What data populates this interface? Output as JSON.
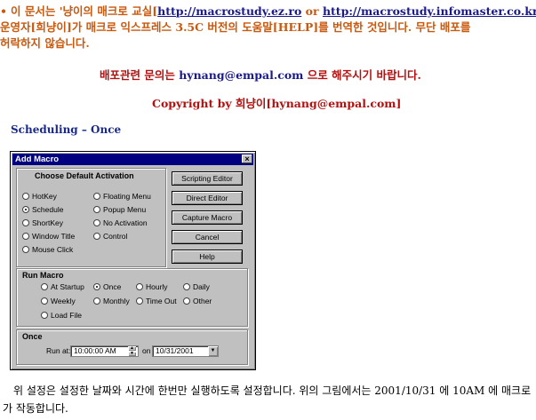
{
  "header": {
    "bullet": "•",
    "line1_prefix": "이 문서는 '냥이의 매크로 교실[",
    "link1": "http://macrostudy.ez.ro",
    "line1_or": " or ",
    "link2": "http://macrostudy.infomaster.co.kr",
    "line1_suffix": "]'",
    "line2": "운영자[희냥이]가 매크로 익스프레스 3.5C 버전의 도움말[HELP]를 번역한 것입니다. 무단 배포를",
    "line3": "허락하지 않습니다.",
    "contact_prefix": "배포관련 문의는 ",
    "contact_email": "hynang@empal.com",
    "contact_suffix": " 으로 해주시기 바랍니다.",
    "copyright": "Copyright by 희냥이[hynang@empal.com]"
  },
  "section_title": "Scheduling – Once",
  "dialog": {
    "title": "Add Macro",
    "close_glyph": "×",
    "activation": {
      "title": "Choose Default Activation",
      "options": [
        {
          "label": "HotKey",
          "selected": false
        },
        {
          "label": "Schedule",
          "selected": true
        },
        {
          "label": "ShortKey",
          "selected": false
        },
        {
          "label": "Window Title",
          "selected": false
        },
        {
          "label": "Mouse Click",
          "selected": false
        },
        {
          "label": "Floating Menu",
          "selected": false
        },
        {
          "label": "Popup Menu",
          "selected": false
        },
        {
          "label": "No Activation",
          "selected": false
        },
        {
          "label": "Control",
          "selected": false
        }
      ]
    },
    "buttons": {
      "scripting_editor": "Scripting Editor",
      "direct_editor": "Direct Editor",
      "capture_macro": "Capture Macro",
      "cancel": "Cancel",
      "help": "Help"
    },
    "run_macro": {
      "title": "Run Macro",
      "options": [
        {
          "label": "At Startup",
          "selected": false
        },
        {
          "label": "Once",
          "selected": true
        },
        {
          "label": "Hourly",
          "selected": false
        },
        {
          "label": "Daily",
          "selected": false
        },
        {
          "label": "Weekly",
          "selected": false
        },
        {
          "label": "Monthly",
          "selected": false
        },
        {
          "label": "Time Out",
          "selected": false
        },
        {
          "label": "Other",
          "selected": false
        },
        {
          "label": "Load File",
          "selected": false
        }
      ]
    },
    "once": {
      "title": "Once",
      "run_at_label": "Run at:",
      "time_value": "10:00:00 AM",
      "on_label": "on",
      "date_value": "10/31/2001",
      "spin_up": "▲",
      "spin_down": "▼",
      "dropdown_glyph": "▼"
    }
  },
  "footer": {
    "text": "위 설정은 설정한 날짜와 시간에 한번만 실행하도록 설정합니다. 위의 그림에서는 2001/10/31 에 10AM 에 매크로가 작동합니다."
  }
}
